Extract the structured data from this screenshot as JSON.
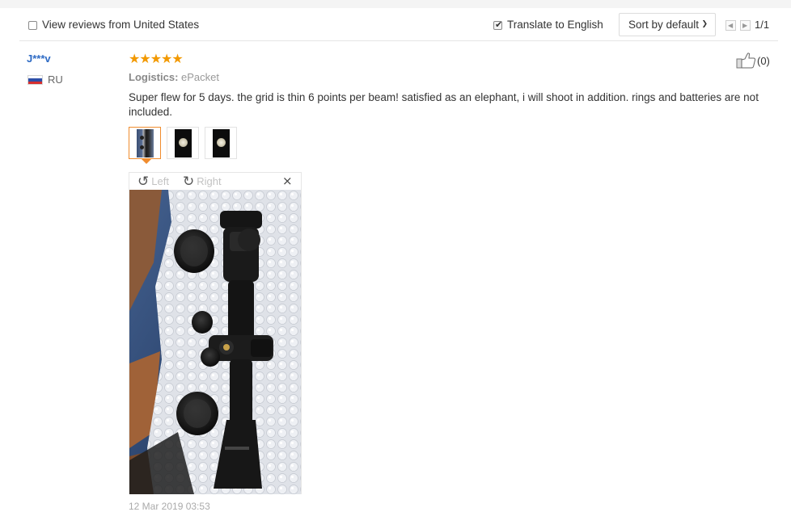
{
  "filter": {
    "view_reviews_label": "View reviews from United States",
    "view_reviews_checked": false,
    "translate_label": "Translate to English",
    "translate_checked": true,
    "sort_label": "Sort by default",
    "page_indicator": "1/1"
  },
  "review": {
    "username": "J***v",
    "country": "RU",
    "rating": 5,
    "stars_text": "★★★★★",
    "logistics_label": "Logistics:",
    "logistics_value": "ePacket",
    "text": "Super flew for 5 days. the grid is thin 6 points per beam! satisfied as an elephant, i will shoot in addition. rings and batteries are not included.",
    "helpful_count": "(0)",
    "photos_count": 3,
    "date": "12 Mar 2019 03:53"
  },
  "viewer": {
    "rotate_left_label": "Left",
    "rotate_right_label": "Right",
    "close_label": "×"
  },
  "colors": {
    "username": "#2d6ac4",
    "star": "#f29900",
    "active_thumb": "#f08c2e"
  }
}
